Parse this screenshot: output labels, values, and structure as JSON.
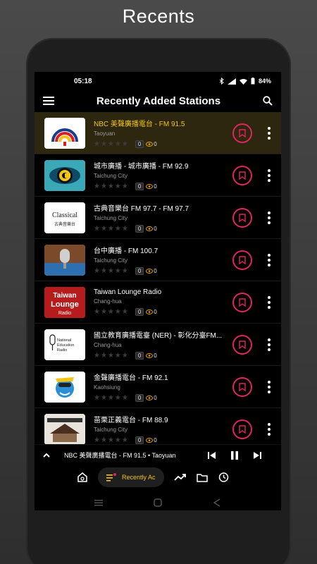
{
  "heading": "Recents",
  "status": {
    "time": "05:18",
    "battery": "84%"
  },
  "appbar": {
    "title": "Recently Added Stations"
  },
  "stations": [
    {
      "name": "NBC 美聲廣播電台 - FM 91.5",
      "city": "Taoyuan",
      "count": "0",
      "views": "0",
      "active": true
    },
    {
      "name": "城市廣播 - 城市廣播 - FM 92.9",
      "city": "Taichung City",
      "count": "0",
      "views": "0"
    },
    {
      "name": "古典音樂台 FM 97.7 - FM 97.7",
      "city": "Taichung City",
      "count": "0",
      "views": "0"
    },
    {
      "name": "台中廣播 - FM 100.7",
      "city": "Taichung City",
      "count": "0",
      "views": "0"
    },
    {
      "name": "Taiwan Lounge Radio",
      "city": "Chang-hua",
      "count": "0",
      "views": "0"
    },
    {
      "name": "國立教育廣播電臺 (NER) - 彰化分臺FM...",
      "city": "Chang-hua",
      "count": "0",
      "views": "0"
    },
    {
      "name": "金聲廣播電台 - FM 92.1",
      "city": "Kaohsiung",
      "count": "0",
      "views": "0"
    },
    {
      "name": "苗栗正義電台 - FM 88.9",
      "city": "Taichung City",
      "count": "0",
      "views": "0"
    }
  ],
  "logos": {
    "l3_text1": "Classical",
    "l3_text2": "古典音樂台",
    "l5_text1": "Taiwan",
    "l5_text2": "Lounge",
    "l5_text3": "Radio",
    "l6_text1": "National",
    "l6_text2": "Education",
    "l6_text3": "Radio"
  },
  "player": {
    "now_playing": "NBC 美聲廣播電台 - FM 91.5 • Taoyuan"
  },
  "nav": {
    "active_label": "Recently Ac"
  },
  "colors": {
    "accent": "#f0c419",
    "favorite": "#e0245e",
    "active_row": "#2e2710"
  }
}
